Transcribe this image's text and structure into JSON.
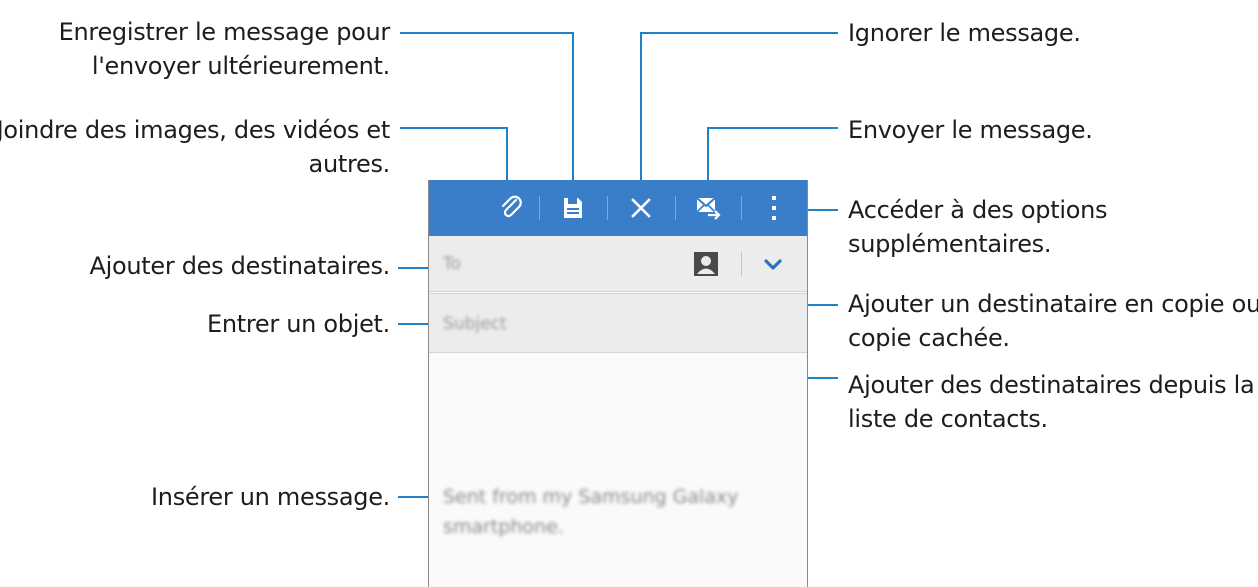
{
  "callouts": {
    "save": [
      "Enregistrer le message pour",
      "l'envoyer ultérieurement."
    ],
    "attach": [
      "Joindre des images, des vidéos et",
      "autres."
    ],
    "recipients": "Ajouter des destinataires.",
    "subject": "Entrer un objet.",
    "message": "Insérer un message.",
    "discard": "Ignorer le message.",
    "send": "Envoyer le message.",
    "more": [
      "Accéder à des options",
      "supplémentaires."
    ],
    "cc_bcc": [
      "Ajouter un destinataire en copie ou",
      "copie cachée."
    ],
    "contacts": [
      "Ajouter des destinataires depuis la",
      "liste de contacts."
    ]
  },
  "compose": {
    "to_placeholder": "To",
    "subject_placeholder": "Subject",
    "signature": "Sent from my Samsung Galaxy smartphone."
  },
  "colors": {
    "appbar": "#3a7dc8",
    "callout_line": "#1e82c8"
  },
  "icons": {
    "attach": "paperclip-icon",
    "save": "save-icon",
    "discard": "close-icon",
    "send": "send-mail-icon",
    "more": "more-vertical-icon",
    "contacts": "contact-icon",
    "expand": "chevron-down-icon"
  }
}
